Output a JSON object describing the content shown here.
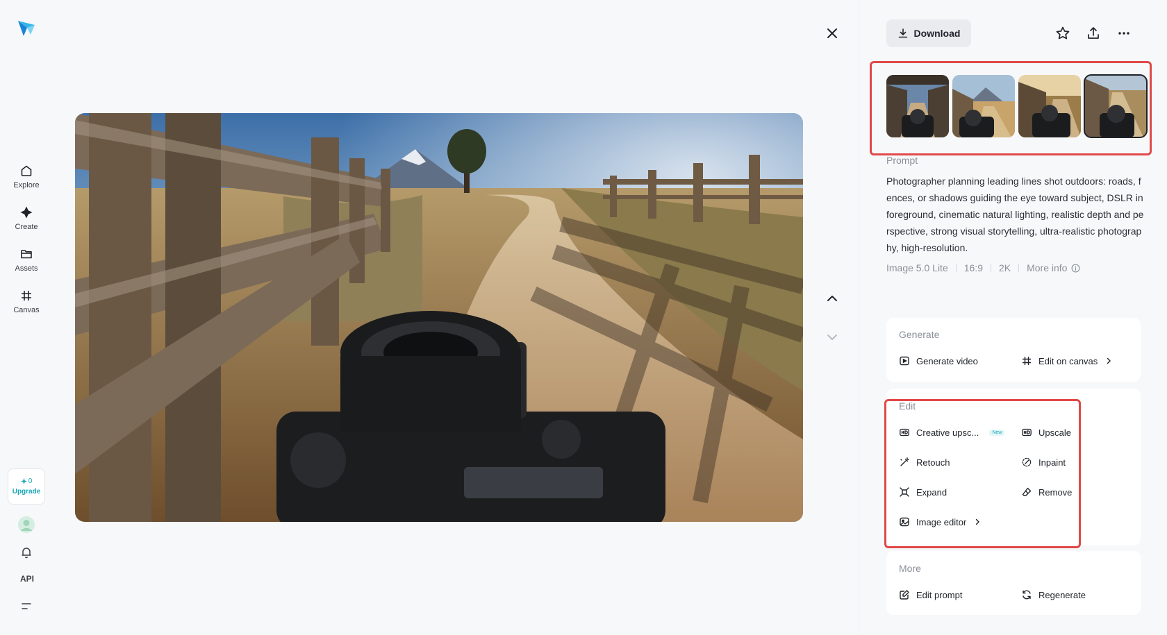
{
  "rail": {
    "items": [
      {
        "label": "Explore",
        "icon": "home-icon"
      },
      {
        "label": "Create",
        "icon": "sparkle-icon"
      },
      {
        "label": "Assets",
        "icon": "folder-icon"
      },
      {
        "label": "Canvas",
        "icon": "grid-icon"
      }
    ],
    "credits": "0",
    "upgrade_label": "Upgrade",
    "api_label": "API"
  },
  "toolbar": {
    "download_label": "Download"
  },
  "prompt": {
    "label": "Prompt",
    "text": "Photographer planning leading lines shot outdoors: roads, fences, or shadows guiding the eye toward subject, DSLR in foreground, cinematic natural lighting, realistic depth and perspective, strong visual storytelling, ultra-realistic photography, high-resolution."
  },
  "meta": {
    "model": "Image 5.0 Lite",
    "ratio": "16:9",
    "resolution": "2K",
    "more_info": "More info"
  },
  "generate": {
    "title": "Generate",
    "generate_video": "Generate video",
    "edit_on_canvas": "Edit on canvas"
  },
  "edit": {
    "title": "Edit",
    "creative_upscale": "Creative upsc...",
    "new_badge": "New",
    "upscale": "Upscale",
    "retouch": "Retouch",
    "inpaint": "Inpaint",
    "expand": "Expand",
    "remove": "Remove",
    "image_editor": "Image editor"
  },
  "more": {
    "title": "More",
    "edit_prompt": "Edit prompt",
    "regenerate": "Regenerate"
  },
  "colors": {
    "accent": "#1aa6b7",
    "highlight": "#e04848"
  }
}
